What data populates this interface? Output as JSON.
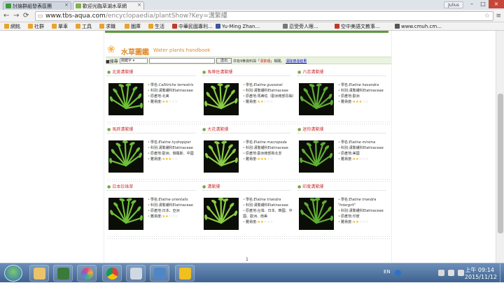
{
  "browser": {
    "tabs": [
      {
        "label": "討論群組發表區團",
        "favicon_color": "#3b9a3b",
        "active": false
      },
      {
        "label": "歡迎光臨草湖水草網",
        "favicon_color": "#7fb34a",
        "active": true
      }
    ],
    "user_label": "Julius",
    "address": {
      "host": "www.tbs-aqua.com",
      "path": "/encyclopaedia/plantShow?Key=溝繁縷"
    },
    "bookmarks": [
      {
        "label": "網銘",
        "color": "#e8a32d"
      },
      {
        "label": "社群",
        "color": "#e8a32d"
      },
      {
        "label": "單車",
        "color": "#e8a32d"
      },
      {
        "label": "工具",
        "color": "#e8a32d"
      },
      {
        "label": "求職",
        "color": "#e8a32d"
      },
      {
        "label": "圖庫",
        "color": "#e8a32d"
      },
      {
        "label": "生活",
        "color": "#e8a32d"
      },
      {
        "label": "中華民國專利...",
        "color": "#c0392b"
      },
      {
        "label": "Yu-Ming Zhan...",
        "color": "#3b5998"
      },
      {
        "label": "忍受旁人眼...",
        "color": "#777777"
      },
      {
        "label": "空中美語文教事...",
        "color": "#c0392b"
      },
      {
        "label": "www.cmuh.cm...",
        "color": "#555555"
      }
    ]
  },
  "page": {
    "title": "水草圖鑑",
    "subtitle": "Water plants handbook",
    "search": {
      "label": "搜尋",
      "select_value": "關鍵字",
      "button_label": "送出",
      "result_prefix": "共有9筆資料與「",
      "result_keyword": "溝繁縷",
      "result_suffix": "」相關。",
      "clear_label": "清除搜尋結果"
    },
    "labels": {
      "sci": "學名:",
      "family": "科別:",
      "origin": "原產地:",
      "difficulty": "難易度:"
    },
    "plants": [
      {
        "name": "北美溝繁縷",
        "scientific": "Callitriche terrestris",
        "family": "溝繁縷科Elatinaceae",
        "origin": "北美",
        "stars": 2
      },
      {
        "name": "馬蒂佐溝繁縷",
        "scientific": "Elatine gussonei",
        "family": "溝繁縷科Elatinaceae",
        "origin": "馬蒂佐（歐洲南部島嶼）",
        "stars": 2
      },
      {
        "name": "六蕊溝繁縷",
        "scientific": "Elatine hexandra",
        "family": "溝繁縷科Elatinaceae",
        "origin": "歐洲",
        "stars": 3
      },
      {
        "name": "馬胖溝繁縷",
        "scientific": "Elatine hydropiper",
        "family": "溝繁縷科Elatinaceae",
        "origin": "歐洲、俄羅斯、中國",
        "stars": 3
      },
      {
        "name": "大花溝繁縷",
        "scientific": "Elatine macropoda",
        "family": "溝繁縷科Elatinaceae",
        "origin": "歐洲南部和北非",
        "stars": 3
      },
      {
        "name": "迷你溝繁縷",
        "scientific": "Elatine minima",
        "family": "溝繁縷科Elatinaceae",
        "origin": "美國",
        "stars": 2
      },
      {
        "name": "日本珍珠草",
        "scientific": "Elatine orientalis",
        "family": "溝繁縷科Elatinaceae",
        "origin": "日本、亞洲",
        "stars": 2
      },
      {
        "name": "溝繁縷",
        "scientific": "Elatine triandra",
        "family": "溝繁縷科Elatinaceae",
        "origin": "台灣、日本、韓國、中國、歐洲、南美",
        "stars": 2
      },
      {
        "name": "印度溝繁縷",
        "scientific": "Elatine triandra \"Intergrit\"",
        "family": "溝繁縷科Elatinaceae",
        "origin": "印度",
        "stars": 2
      }
    ],
    "pagination": "1"
  },
  "taskbar": {
    "apps": [
      {
        "name": "file-explorer",
        "color": "#e9c46a"
      },
      {
        "name": "terminal",
        "color": "#3a7a3a"
      },
      {
        "name": "picasa",
        "color": "#d94f70"
      },
      {
        "name": "chrome",
        "color": "#e0c020"
      },
      {
        "name": "calculator",
        "color": "#cfd8e3"
      },
      {
        "name": "remote-desktop",
        "color": "#4f86c6"
      },
      {
        "name": "rescuetime",
        "color": "#f0c020"
      }
    ],
    "language": "EN",
    "time": "上午 09:14",
    "date": "2015/11/12"
  }
}
